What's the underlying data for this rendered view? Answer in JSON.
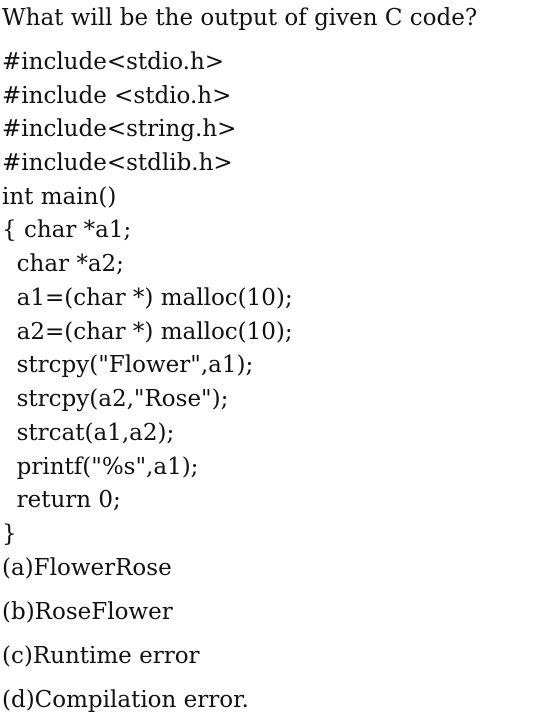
{
  "question": "What will be the output of given C code?",
  "code_lines": [
    "#include<stdio.h>",
    "#include <stdio.h>",
    "#include<string.h>",
    "#include<stdlib.h>",
    "int main()",
    "{ char *a1;",
    "  char *a2;",
    "  a1=(char *) malloc(10);",
    "  a2=(char *) malloc(10);",
    "  strcpy(\"Flower\",a1);",
    "  strcpy(a2,\"Rose\");",
    "  strcat(a1,a2);",
    "  printf(\"%s\",a1);",
    "  return 0;",
    "}"
  ],
  "options": [
    "(a)FlowerRose",
    "(b)RoseFlower",
    "(c)Runtime error",
    "(d)Compilation error."
  ]
}
